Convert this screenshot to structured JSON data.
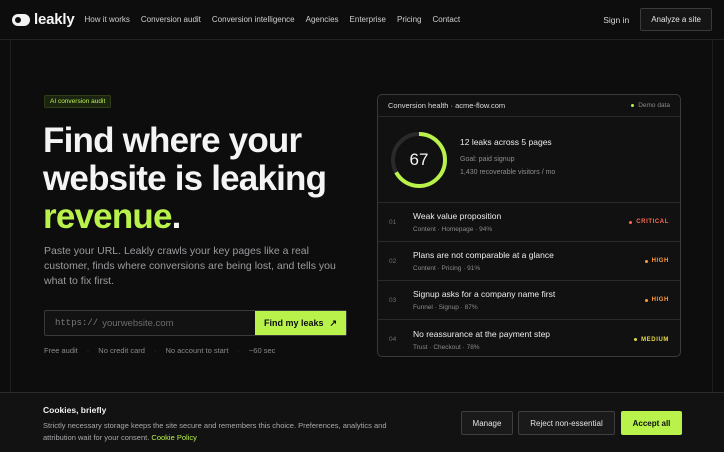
{
  "nav": {
    "logo_text": "leakly",
    "links": [
      "How it works",
      "Conversion audit",
      "Conversion intelligence",
      "Agencies",
      "Enterprise",
      "Pricing",
      "Contact"
    ],
    "signin_label": "Sign in",
    "analyze_label": "Analyze a site",
    "analyze_arrow": "↗"
  },
  "hero": {
    "badge": "AI conversion audit",
    "headline_line1": "Find where your",
    "headline_line2": "website is leaking",
    "headline_accent": "revenue",
    "headline_period": ".",
    "subtitle": "Paste your URL. Leakly crawls your key pages like a real customer, finds where conversions are being lost, and tells you what to fix first.",
    "url_prefix": "https://",
    "url_placeholder": "yourwebsite.com",
    "find_label": "Find my leaks",
    "find_arrow": "↗",
    "meta": [
      "Free audit",
      "No credit card",
      "No account to start",
      "~60 sec"
    ],
    "meta_sep": "·"
  },
  "card": {
    "title": "Conversion health · acme-flow.com",
    "demo_label": "Demo data",
    "score": "67",
    "score_fraction": 0.67,
    "summary": "12 leaks across 5 pages",
    "goal": "Goal: paid signup",
    "recoverable": "1,430 recoverable visitors / mo",
    "leaks": [
      {
        "num": "01",
        "title": "Weak value proposition",
        "meta": "Content · Homepage · 94%",
        "severity": "CRITICAL",
        "color": "#ff6a4d"
      },
      {
        "num": "02",
        "title": "Plans are not comparable at a glance",
        "meta": "Content · Pricing · 91%",
        "severity": "HIGH",
        "color": "#ff9a3c"
      },
      {
        "num": "03",
        "title": "Signup asks for a company name first",
        "meta": "Funnel · Signup · 87%",
        "severity": "HIGH",
        "color": "#ff9a3c"
      },
      {
        "num": "04",
        "title": "No reassurance at the payment step",
        "meta": "Trust · Checkout · 78%",
        "severity": "MEDIUM",
        "color": "#e8d84a"
      }
    ]
  },
  "cookie": {
    "title": "Cookies, briefly",
    "body": "Strictly necessary storage keeps the site secure and remembers this choice. Preferences, analytics and attribution wait for your consent.",
    "link": "Cookie Policy",
    "manage": "Manage",
    "reject": "Reject non-essential",
    "accept": "Accept all"
  },
  "colors": {
    "accent": "#b9f24a",
    "background": "#0d0d0e"
  }
}
